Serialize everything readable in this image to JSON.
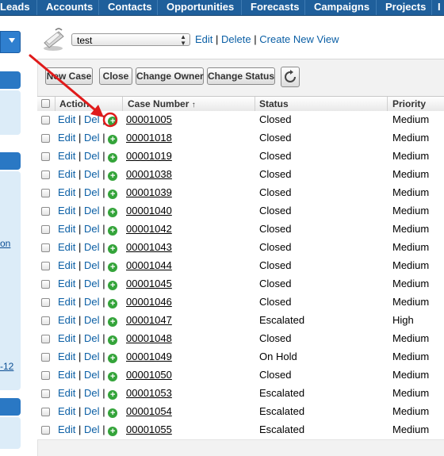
{
  "nav": {
    "tabs": [
      "Leads",
      "Accounts",
      "Contacts",
      "Opportunities",
      "Forecasts",
      "Campaigns",
      "Projects",
      "I"
    ]
  },
  "sidebar": {
    "texts": [
      "on",
      "-12"
    ]
  },
  "view": {
    "selected": "test",
    "edit": "Edit",
    "delete": "Delete",
    "create_new_view": "Create New View"
  },
  "toolbar": {
    "new_case": "New Case",
    "close": "Close",
    "change_owner": "Change Owner",
    "change_status": "Change Status"
  },
  "table": {
    "headers": {
      "action": "Action",
      "case_number": "Case Number",
      "status": "Status",
      "priority": "Priority"
    },
    "action_labels": {
      "edit": "Edit",
      "del": "Del",
      "sep": "|"
    },
    "rows": [
      {
        "case_number": "00001005",
        "status": "Closed",
        "priority": "Medium"
      },
      {
        "case_number": "00001018",
        "status": "Closed",
        "priority": "Medium"
      },
      {
        "case_number": "00001019",
        "status": "Closed",
        "priority": "Medium"
      },
      {
        "case_number": "00001038",
        "status": "Closed",
        "priority": "Medium"
      },
      {
        "case_number": "00001039",
        "status": "Closed",
        "priority": "Medium"
      },
      {
        "case_number": "00001040",
        "status": "Closed",
        "priority": "Medium"
      },
      {
        "case_number": "00001042",
        "status": "Closed",
        "priority": "Medium"
      },
      {
        "case_number": "00001043",
        "status": "Closed",
        "priority": "Medium"
      },
      {
        "case_number": "00001044",
        "status": "Closed",
        "priority": "Medium"
      },
      {
        "case_number": "00001045",
        "status": "Closed",
        "priority": "Medium"
      },
      {
        "case_number": "00001046",
        "status": "Closed",
        "priority": "Medium"
      },
      {
        "case_number": "00001047",
        "status": "Escalated",
        "priority": "High"
      },
      {
        "case_number": "00001048",
        "status": "Closed",
        "priority": "Medium"
      },
      {
        "case_number": "00001049",
        "status": "On Hold",
        "priority": "Medium"
      },
      {
        "case_number": "00001050",
        "status": "Closed",
        "priority": "Medium"
      },
      {
        "case_number": "00001053",
        "status": "Escalated",
        "priority": "Medium"
      },
      {
        "case_number": "00001054",
        "status": "Escalated",
        "priority": "Medium"
      },
      {
        "case_number": "00001055",
        "status": "Escalated",
        "priority": "Medium"
      }
    ]
  },
  "annotation": {
    "color": "#e01b1b"
  },
  "colors": {
    "nav_bg": "#1f5f9b",
    "link": "#0b5fa5",
    "plus_icon": "#34a43a"
  }
}
